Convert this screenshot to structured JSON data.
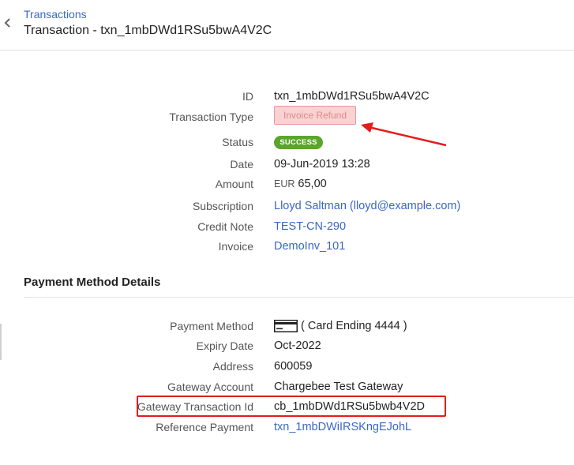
{
  "header": {
    "breadcrumb": "Transactions",
    "title": "Transaction - txn_1mbDWd1RSu5bwA4V2C"
  },
  "details": {
    "id_label": "ID",
    "id_value": "txn_1mbDWd1RSu5bwA4V2C",
    "type_label": "Transaction Type",
    "type_value": "Invoice Refund",
    "status_label": "Status",
    "status_value": "SUCCESS",
    "date_label": "Date",
    "date_value": "09-Jun-2019 13:28",
    "amount_label": "Amount",
    "amount_currency": "EUR",
    "amount_value": "65,00",
    "subscription_label": "Subscription",
    "subscription_value": "Lloyd Saltman (lloyd@example.com)",
    "credit_note_label": "Credit Note",
    "credit_note_value": "TEST-CN-290",
    "invoice_label": "Invoice",
    "invoice_value": "DemoInv_101"
  },
  "payment_method": {
    "section_title": "Payment Method Details",
    "method_label": "Payment Method",
    "method_value": "( Card Ending 4444 )",
    "method_icon": "credit-card-icon",
    "expiry_label": "Expiry Date",
    "expiry_value": "Oct-2022",
    "address_label": "Address",
    "address_value": "600059",
    "gateway_account_label": "Gateway Account",
    "gateway_account_value": "Chargebee Test Gateway",
    "gateway_txn_label": "Gateway Transaction Id",
    "gateway_txn_value": "cb_1mbDWd1RSu5bwb4V2D",
    "reference_label": "Reference Payment",
    "reference_value": "txn_1mbDWiIRSKngEJohL"
  },
  "colors": {
    "link": "#3a66c9",
    "success": "#5aa52a",
    "refund_bg": "#f9d2d2",
    "annotation": "#e31c1c"
  }
}
